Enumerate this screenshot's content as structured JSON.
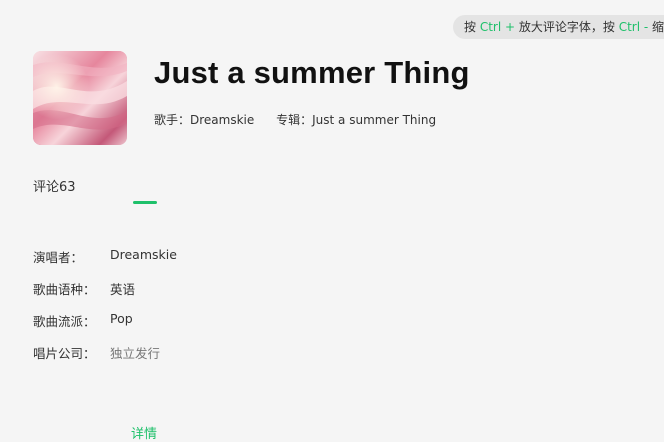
{
  "hint": {
    "prefix": "按 ",
    "zoom_in_key": "Ctrl +",
    "zoom_in_text": " 放大评论字体，按 ",
    "zoom_out_key": "Ctrl -",
    "zoom_out_text": " 缩"
  },
  "song": {
    "title": "Just a summer Thing",
    "artist_label": "歌手：",
    "artist": "Dreamskie",
    "album_label": "专辑：",
    "album": "Just a summer Thing"
  },
  "tabs": [
    {
      "label": "评论63",
      "active": false
    },
    {
      "label": "详情",
      "active": true
    }
  ],
  "details": [
    {
      "label": "演唱者：",
      "value": "Dreamskie"
    },
    {
      "label": "歌曲语种：",
      "value": "英语"
    },
    {
      "label": "歌曲流派：",
      "value": "Pop"
    },
    {
      "label": "唱片公司：",
      "value": "独立发行"
    }
  ],
  "colors": {
    "accent": "#1ec06a",
    "background": "#f5f5f5"
  }
}
